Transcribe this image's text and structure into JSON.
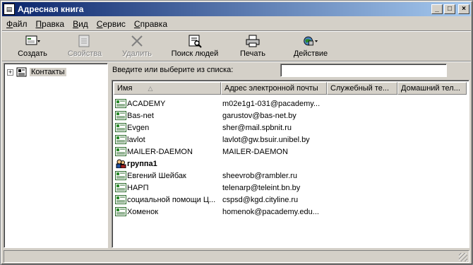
{
  "window": {
    "title": "Адресная книга"
  },
  "menu": [
    "Файл",
    "Правка",
    "Вид",
    "Сервис",
    "Справка"
  ],
  "toolbar": [
    {
      "label": "Создать",
      "icon": "new-contact-icon",
      "enabled": true
    },
    {
      "label": "Свойства",
      "icon": "properties-icon",
      "enabled": false
    },
    {
      "label": "Удалить",
      "icon": "delete-icon",
      "enabled": false
    },
    {
      "label": "Поиск людей",
      "icon": "find-people-icon",
      "enabled": true
    },
    {
      "label": "Печать",
      "icon": "print-icon",
      "enabled": true
    },
    {
      "label": "Действие",
      "icon": "action-icon",
      "enabled": true
    }
  ],
  "tree": {
    "root_label": "Контакты",
    "expander": "+"
  },
  "search": {
    "prompt": "Введите или выберите из списка:",
    "value": ""
  },
  "columns": [
    "Имя",
    "Адрес электронной почты",
    "Служебный те...",
    "Домашний тел..."
  ],
  "rows": [
    {
      "name": "ACADEMY",
      "email": "m02e1g1-031@pacademy...",
      "type": "contact"
    },
    {
      "name": "Bas-net",
      "email": "garustov@bas-net.by",
      "type": "contact"
    },
    {
      "name": "Evgen",
      "email": "sher@mail.spbnit.ru",
      "type": "contact"
    },
    {
      "name": "lavlot",
      "email": "lavlot@gw.bsuir.unibel.by",
      "type": "contact"
    },
    {
      "name": "MAILER-DAEMON",
      "email": "MAILER-DAEMON",
      "type": "contact"
    },
    {
      "name": "группа1",
      "email": "",
      "type": "group"
    },
    {
      "name": "Евгений Шейбак",
      "email": "sheevrob@rambler.ru",
      "type": "contact"
    },
    {
      "name": "НАРП",
      "email": "telenarp@teleint.bn.by",
      "type": "contact"
    },
    {
      "name": "социальной помощи Ц...",
      "email": "cspsd@kgd.cityline.ru",
      "type": "contact"
    },
    {
      "name": "Хоменок",
      "email": "homenok@pacademy.edu...",
      "type": "contact"
    }
  ],
  "colors": {
    "titlebar_start": "#0a246a",
    "titlebar_end": "#a6caf0",
    "face": "#d4d0c8"
  }
}
